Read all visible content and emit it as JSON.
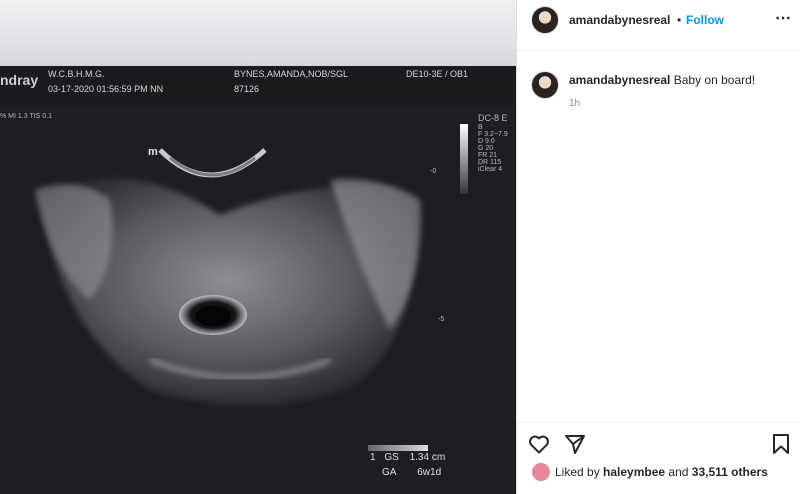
{
  "post": {
    "username": "amandabynesreal",
    "follow_label": "Follow",
    "dot": "•",
    "more_icon": "more-options-icon",
    "caption_username": "amandabynesreal",
    "caption_text": "Baby on board!",
    "time_ago": "1h",
    "liked_by_prefix": "Liked by ",
    "liked_by_user": "haleymbee",
    "liked_by_and": " and ",
    "liked_by_count": "33,511 others"
  },
  "scan": {
    "brand": "ndray",
    "clinic": "W.C.B.H.M.G.",
    "datetime": "03-17-2020  01:56:59 PM  NN",
    "patient": "BYNES,AMANDA,NOB/SGL",
    "patient_id": "87126",
    "probe": "DE10-3E / OB1",
    "mi_ti": "% MI 1.3 TIS 0.1",
    "dc": "DC-8 E",
    "marker_m": "m",
    "params": [
      "B",
      "F 3.2~7.9",
      "D 9.0",
      "G 20",
      "FR 21",
      "DR 115",
      "iClear 4"
    ],
    "depth_0": "-0",
    "depth_5": "-5",
    "gs_label": "GS",
    "gs_value": "1.34 cm",
    "ga_label": "GA",
    "ga_value": "6w1d",
    "marker_1": "1"
  },
  "colors": {
    "follow": "#0095f6",
    "text": "#262626",
    "muted": "#8e8e8e",
    "media_bg": "#1b1b1e"
  }
}
